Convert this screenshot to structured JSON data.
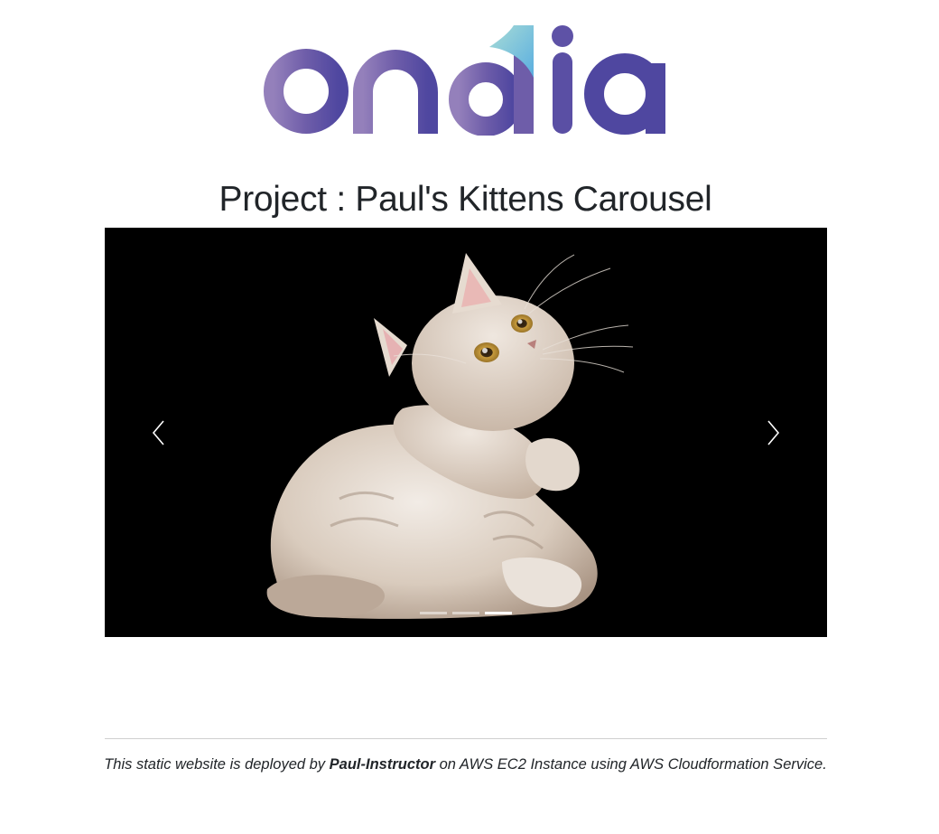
{
  "logo": {
    "text": "ondia",
    "colors": [
      "#8f7bb8",
      "#7d6cb0",
      "#5e4fa3",
      "#4c45a0",
      "#6ec1e4",
      "#a8dcd6"
    ]
  },
  "header": {
    "title": "Project : Paul's Kittens Carousel"
  },
  "carousel": {
    "slide_image": "kitten-looking-up-photo",
    "prev_icon": "chevron-left-icon",
    "next_icon": "chevron-right-icon",
    "indicator_count": 3,
    "active_indicator": 3
  },
  "footer": {
    "text_before": "This static website is deployed by ",
    "author": "Paul-Instructor",
    "text_after": " on AWS EC2 Instance using AWS Cloudformation Service."
  }
}
